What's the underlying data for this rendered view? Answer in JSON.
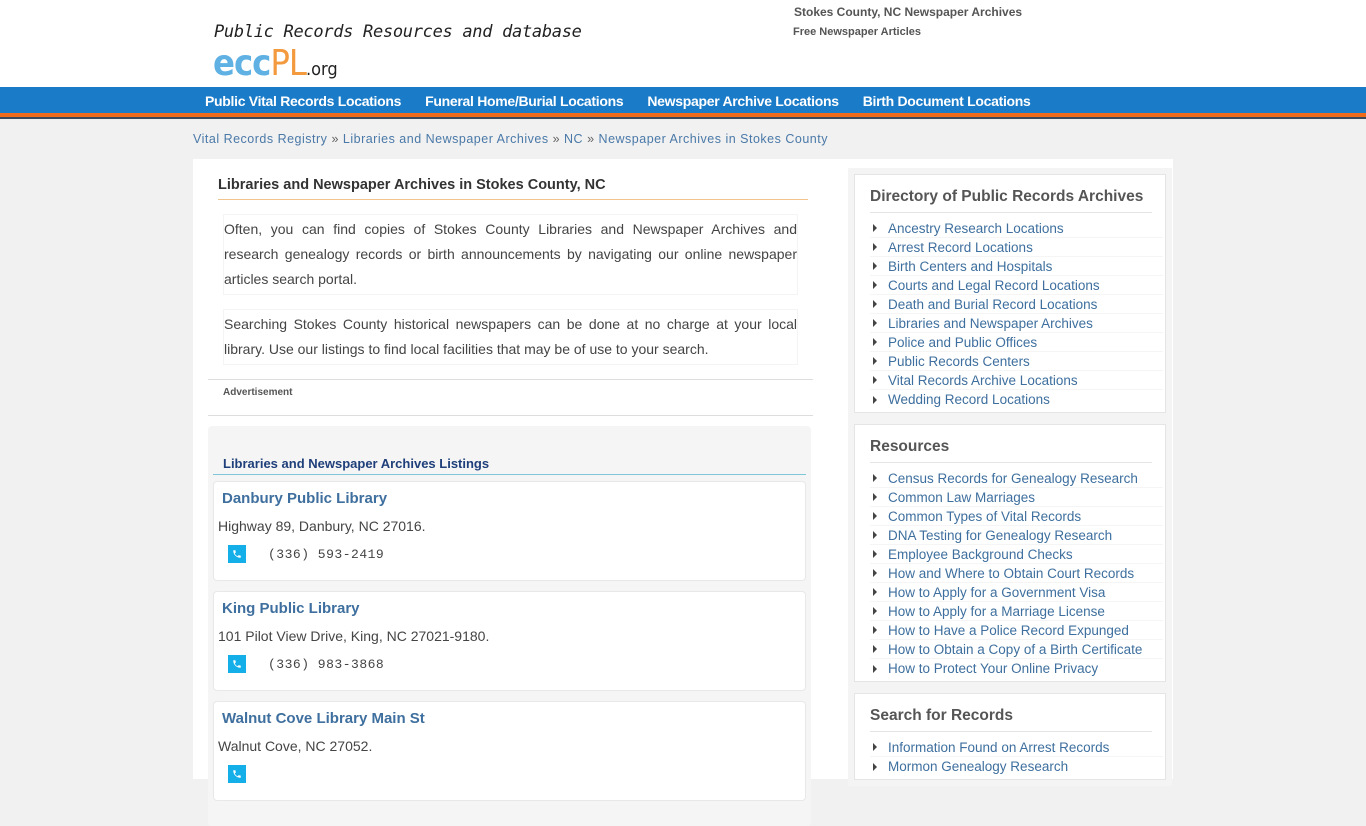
{
  "header": {
    "tagline": "Public Records Resources and database",
    "logo": {
      "part1": "ecc",
      "part2": "PL",
      "part3": ".org"
    },
    "site_title": "Stokes County, NC Newspaper Archives",
    "site_subtitle": "Free Newspaper Articles"
  },
  "colors": {
    "nav_bg": "#1a7bc8",
    "nav_accent": "#ef6a1b",
    "link": "#3e6f9e",
    "phone_icon": "#14aee8"
  },
  "nav": {
    "items": [
      {
        "label": "Public Vital Records Locations"
      },
      {
        "label": "Funeral Home/Burial Locations"
      },
      {
        "label": "Newspaper Archive Locations"
      },
      {
        "label": "Birth Document Locations"
      }
    ]
  },
  "breadcrumb": {
    "separator": "»",
    "items": [
      {
        "label": "Vital Records Registry"
      },
      {
        "label": "Libraries and Newspaper Archives"
      },
      {
        "label": "NC"
      },
      {
        "label": "Newspaper Archives in Stokes County"
      }
    ]
  },
  "main": {
    "title": "Libraries and Newspaper Archives in Stokes County, NC",
    "paragraphs": [
      "Often, you can find copies of Stokes County Libraries and Newspaper Archives and research genealogy records or birth announcements by navigating our online newspaper articles search portal.",
      "Searching Stokes County historical newspapers can be done at no charge at your local library. Use our listings to find local facilities that may be of use to your search."
    ],
    "ad_label": "Advertisement",
    "listings_title": "Libraries and Newspaper Archives Listings",
    "listings": [
      {
        "name": "Danbury Public Library",
        "address": "Highway 89, Danbury, NC 27016.",
        "phone": "(336) 593-2419"
      },
      {
        "name": "King Public Library",
        "address": "101 Pilot View Drive, King, NC 27021-9180.",
        "phone": "(336) 983-3868"
      },
      {
        "name": "Walnut Cove Library Main St",
        "address": "Walnut Cove, NC 27052.",
        "phone": ""
      }
    ]
  },
  "sidebar": {
    "directory": {
      "title": "Directory of Public Records Archives",
      "items": [
        "Ancestry Research Locations",
        "Arrest Record Locations",
        "Birth Centers and Hospitals",
        "Courts and Legal Record Locations",
        "Death and Burial Record Locations",
        "Libraries and Newspaper Archives",
        "Police and Public Offices",
        "Public Records Centers",
        "Vital Records Archive Locations",
        "Wedding Record Locations"
      ]
    },
    "resources": {
      "title": "Resources",
      "items": [
        "Census Records for Genealogy Research",
        "Common Law Marriages",
        "Common Types of Vital Records",
        "DNA Testing for Genealogy Research",
        "Employee Background Checks",
        "How and Where to Obtain Court Records",
        "How to Apply for a Government Visa",
        "How to Apply for a Marriage License",
        "How to Have a Police Record Expunged",
        "How to Obtain a Copy of a Birth Certificate",
        "How to Protect Your Online Privacy"
      ]
    },
    "search": {
      "title": "Search for Records",
      "items": [
        "Information Found on Arrest Records",
        "Mormon Genealogy Research"
      ]
    }
  }
}
